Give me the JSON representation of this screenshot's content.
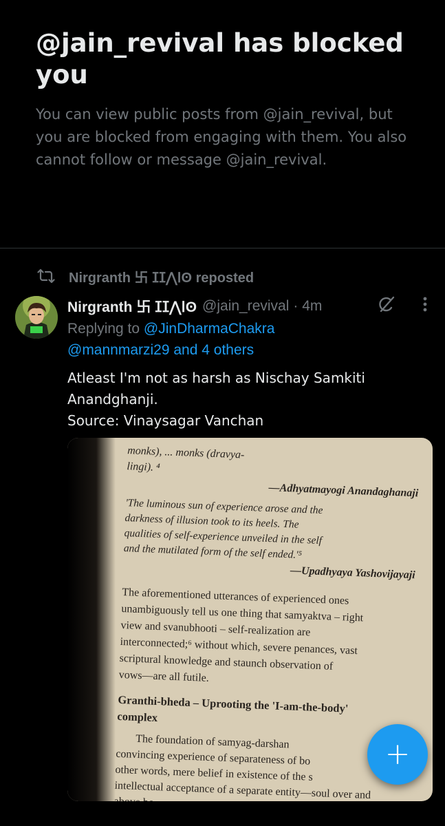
{
  "blocked": {
    "title": "@jain_revival has blocked you",
    "description": "You can view public posts from @jain_revival, but you are blocked from engaging with them. You also cannot follow or message @jain_revival."
  },
  "repost": {
    "icon": "repost-icon",
    "text": "Nirgranth 卐 ⵊⵊ⋀ⵏʘ reposted"
  },
  "post": {
    "author": "Nirgranth 卐 ⵊⵊ⋀ⵏʘ",
    "handle": "@jain_revival",
    "time": "· 4m",
    "replying_prefix": "Replying to ",
    "reply_user1": "@JinDharmaChakra",
    "reply_user2": "@mannmarzi29 and 4 others",
    "text_line1": "Atleast I'm not as harsh as Nischay Samkiti",
    "text_line2": "Anandghanji.",
    "text_line3": "Source: Vinaysagar Vanchan",
    "icons": [
      "grok-icon",
      "more-icon"
    ]
  },
  "media": {
    "l1": "monks), ... monks (dravya-",
    "l2": "lingi). ⁴",
    "l3": "—Adhyatmayogi Anandaghanaji",
    "q1": "'The luminous sun of experience arose and the",
    "q2": "darkness of illusion took to its heels. The",
    "q3": "qualities of self-experience unveiled in the self",
    "q4": "and the mutilated form of the self ended.'⁵",
    "q5": "—Upadhyaya Yashovijayaji",
    "p1": "The aforementioned utterances of experienced ones",
    "p2": "unambiguously tell us one thing that samyaktva – right",
    "p3": "view and svanubhooti – self-realization are",
    "p4": "interconnected;⁶ without which, severe penances, vast",
    "p5": "scriptural knowledge and staunch observation of",
    "p6": "vows—are all futile.",
    "h1": "Granthi-bheda – Uprooting the 'I-am-the-body'",
    "h2": "complex",
    "r1": "The foundation of samyag-darshan",
    "r2": "convincing experience of separateness of bo",
    "r3": "other words, mere belief in existence of the s",
    "r4": "intellectual acceptance of a separate entity—soul over and",
    "r5": "above bo..."
  },
  "fab": {
    "label": "+",
    "icon": "compose-plus-icon"
  }
}
